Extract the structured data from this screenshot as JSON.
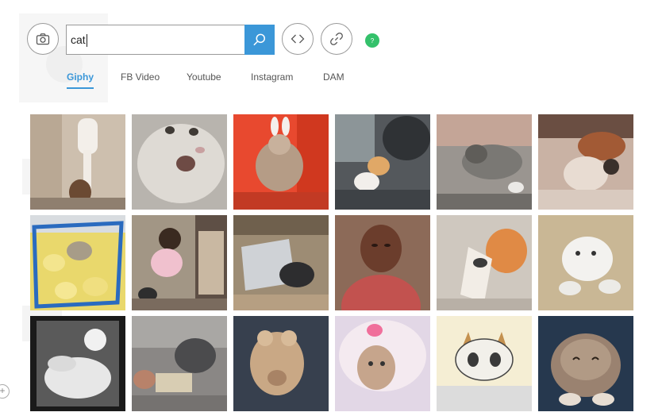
{
  "search": {
    "value": "cat"
  },
  "help": {
    "label": "?"
  },
  "tabs": [
    {
      "label": "Giphy",
      "active": true
    },
    {
      "label": "FB Video",
      "active": false
    },
    {
      "label": "Youtube",
      "active": false
    },
    {
      "label": "Instagram",
      "active": false
    },
    {
      "label": "DAM",
      "active": false
    }
  ],
  "icons": {
    "camera": "camera-icon",
    "search": "search-icon",
    "embed": "code-icon",
    "link": "link-icon",
    "help": "help-icon",
    "add": "plus-icon"
  },
  "add": {
    "label": "+"
  },
  "colors": {
    "accent": "#3b97d8",
    "help": "#34c16b",
    "border": "#9a9a9a"
  }
}
